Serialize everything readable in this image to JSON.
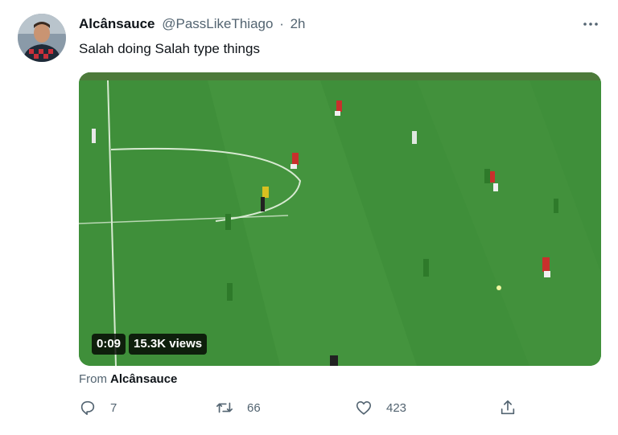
{
  "tweet": {
    "author_name": "Alcânsauce",
    "handle": "@PassLikeThiago",
    "separator": "·",
    "time": "2h",
    "more_icon": "more-horizontal-icon",
    "text": "Salah doing Salah type things"
  },
  "media": {
    "duration": "0:09",
    "views": "15.3K views"
  },
  "attribution": {
    "prefix": "From",
    "source_name": "Alcânsauce"
  },
  "actions": {
    "reply_count": "7",
    "retweet_count": "66",
    "like_count": "423"
  },
  "colors": {
    "pitch": "#3f8f3a",
    "secondary_text": "#536471",
    "primary_text": "#0f1419"
  }
}
